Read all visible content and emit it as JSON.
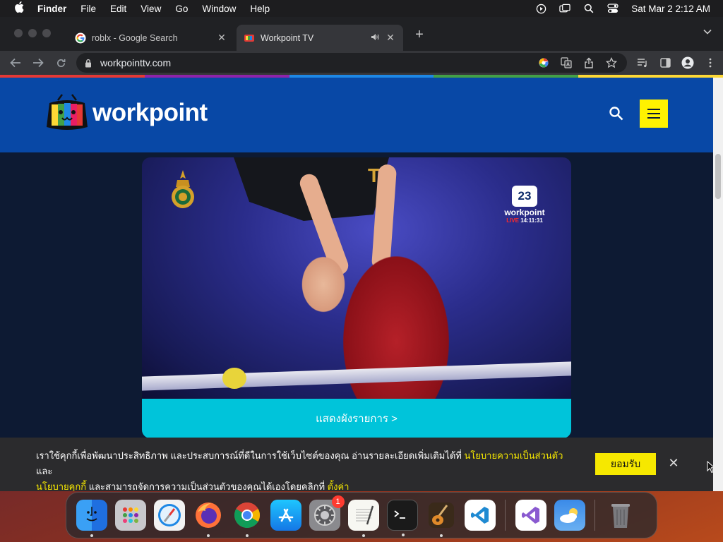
{
  "menubar": {
    "apple": "",
    "app_name": "Finder",
    "items": [
      "File",
      "Edit",
      "View",
      "Go",
      "Window",
      "Help"
    ],
    "status_icons": [
      "play-circle-icon",
      "screen-mirror-icon",
      "spotlight-search-icon",
      "control-center-icon"
    ],
    "clock": "Sat Mar 2  2:12 AM"
  },
  "browser": {
    "tabs": [
      {
        "title": "roblx - Google Search",
        "favicon": "google-icon",
        "active": false
      },
      {
        "title": "Workpoint TV",
        "favicon": "workpoint-icon",
        "active": true
      }
    ],
    "new_tab": "+",
    "url": "workpointtv.com"
  },
  "colors": {
    "header_blue": "#0848a6",
    "menu_yellow": "#fff200",
    "schedule_cyan": "#00c4da",
    "cookie_link_yellow": "#f6e800",
    "accent_line": [
      "#e53935",
      "#8e24aa",
      "#1e88e5",
      "#43a047",
      "#fdd835"
    ]
  },
  "site": {
    "logo_text": "workpoint",
    "video": {
      "channel_number": "23",
      "channel_name": "workpoint",
      "live_label": "LIVE",
      "live_time": "14:11:31",
      "banner_text": "TZ"
    },
    "schedule_label": "แสดงผังรายการ >"
  },
  "cookie": {
    "text_1": "เราใช้คุกกี้เพื่อพัฒนาประสิทธิภาพ และประสบการณ์ที่ดีในการใช้เว็บไซต์ของคุณ อ่านรายละเอียดเพิ่มเติมได้ที่ ",
    "privacy_link": "นโยบายความเป็นส่วนตัว",
    "text_2": " และ",
    "cookie_link": "นโยบายคุกกี้",
    "text_3": " และสามารถจัดการความเป็นส่วนตัวของคุณได้เองโดยคลิกที่ ",
    "settings_link": "ตั้งค่า",
    "accept": "ยอมรับ"
  },
  "dock": {
    "apps": [
      "Finder",
      "Launchpad",
      "Safari",
      "Firefox",
      "Google Chrome",
      "App Store",
      "System Preferences",
      "TextEdit",
      "Terminal",
      "GarageBand",
      "Visual Studio Code",
      "Visual Studio",
      "Weather",
      "Trash"
    ],
    "system_preferences_badge": "1"
  }
}
